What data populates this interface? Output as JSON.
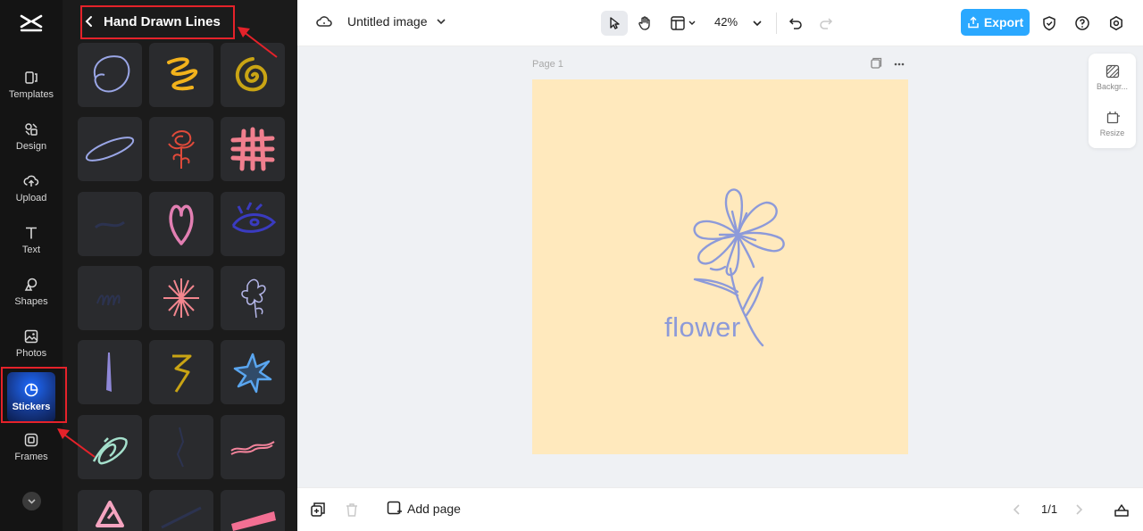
{
  "rail": {
    "items": [
      {
        "label": "Templates",
        "icon": "templates-icon"
      },
      {
        "label": "Design",
        "icon": "design-icon"
      },
      {
        "label": "Upload",
        "icon": "upload-icon"
      },
      {
        "label": "Text",
        "icon": "text-icon"
      },
      {
        "label": "Shapes",
        "icon": "shapes-icon"
      },
      {
        "label": "Photos",
        "icon": "photos-icon"
      },
      {
        "label": "Stickers",
        "icon": "stickers-icon",
        "active": true
      },
      {
        "label": "Frames",
        "icon": "frames-icon"
      }
    ]
  },
  "panel": {
    "title": "Hand Drawn Lines",
    "stickers": [
      {
        "name": "blue-circle-scribble"
      },
      {
        "name": "yellow-loop-scribble"
      },
      {
        "name": "gold-spiral"
      },
      {
        "name": "blue-oval-stroke"
      },
      {
        "name": "red-rose-line"
      },
      {
        "name": "pink-hash-grid"
      },
      {
        "name": "dark-blue-scribble"
      },
      {
        "name": "pink-heart-outline"
      },
      {
        "name": "navy-eye-scribble"
      },
      {
        "name": "dark-wavy-lines"
      },
      {
        "name": "pink-starburst"
      },
      {
        "name": "purple-lily-line"
      },
      {
        "name": "purple-vertical-stroke"
      },
      {
        "name": "gold-zigzag"
      },
      {
        "name": "blue-star-burst"
      },
      {
        "name": "mint-loop-scribble"
      },
      {
        "name": "dark-squiggle"
      },
      {
        "name": "pink-wavy-double-line"
      },
      {
        "name": "pink-triangle-marks"
      },
      {
        "name": "navy-diagonal-stroke"
      },
      {
        "name": "pink-marker-stroke"
      }
    ]
  },
  "topbar": {
    "document_title": "Untitled image",
    "zoom": "42%",
    "export_label": "Export"
  },
  "canvas": {
    "page_label": "Page 1",
    "text": "flower",
    "background": "#ffe9bd",
    "accent": "#8d9ad9"
  },
  "side_tools": {
    "background_label": "Backgr...",
    "resize_label": "Resize"
  },
  "bottombar": {
    "add_page_label": "Add page",
    "pager": "1/1"
  },
  "colors": {
    "highlight": "#e5222a",
    "export_blue": "#2aa8ff",
    "panel_bg": "#1b1b1b"
  }
}
